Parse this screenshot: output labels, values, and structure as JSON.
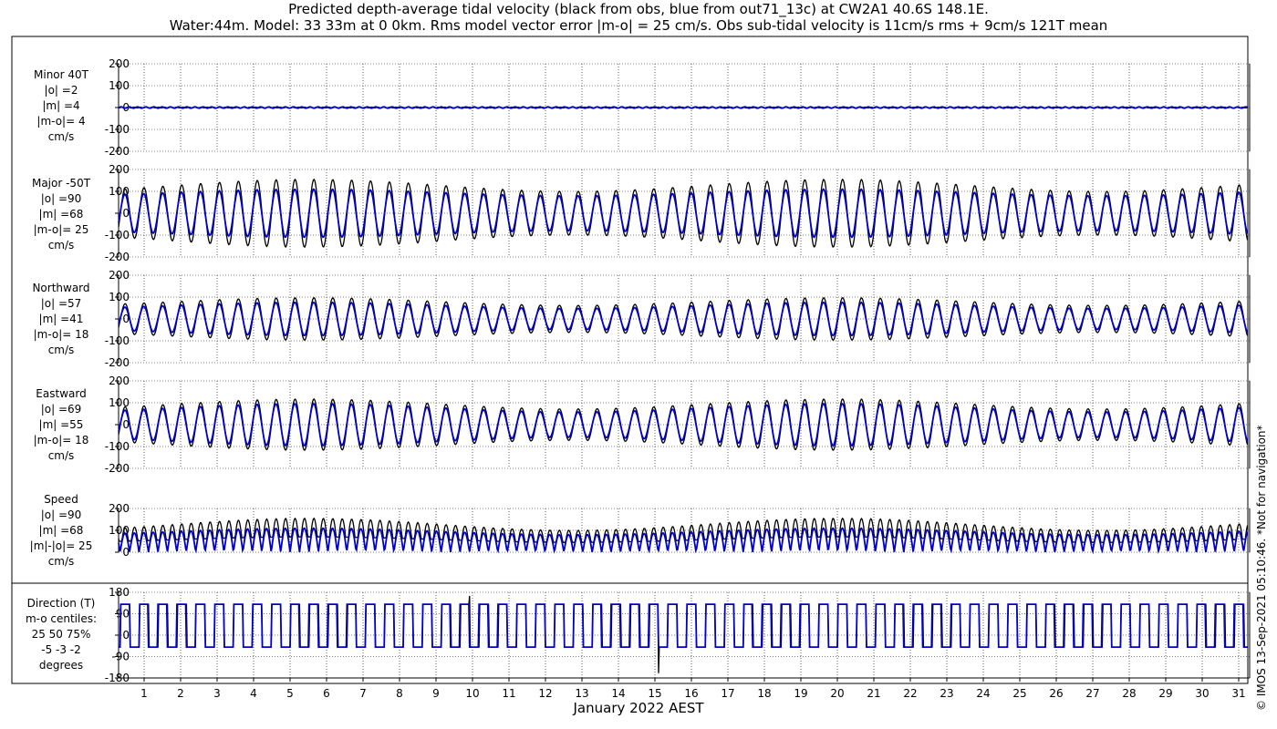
{
  "title_line1": "Predicted depth-average tidal velocity (black from obs, blue from out71_13c) at CW2A1 40.6S 148.1E.",
  "title_line2": "Water:44m. Model: 33 33m at 0 0km. Rms model vector error |m-o| = 25 cm/s. Obs sub-tidal velocity is 11cm/s rms + 9cm/s 121T mean",
  "xlabel": "January 2022 AEST",
  "stamp": "© IMOS 13-Sep-2021 05:10:46. *Not for navigation*",
  "colors": {
    "obs": "#000000",
    "model": "#0000cc",
    "grid": "#000000"
  },
  "panels": [
    {
      "label": [
        "Minor 40T",
        "|o| =2",
        "|m| =4",
        "|m-o|= 4",
        "cm/s"
      ],
      "ylim": [
        -200,
        200
      ],
      "ticks": [
        200,
        100,
        0,
        -100,
        -200
      ]
    },
    {
      "label": [
        "Major -50T",
        "|o| =90",
        "|m| =68",
        "|m-o|= 25",
        "cm/s"
      ],
      "ylim": [
        -200,
        200
      ],
      "ticks": [
        200,
        100,
        0,
        -100,
        -200
      ]
    },
    {
      "label": [
        "Northward",
        "|o| =57",
        "|m| =41",
        "|m-o|= 18",
        "cm/s"
      ],
      "ylim": [
        -200,
        200
      ],
      "ticks": [
        200,
        100,
        0,
        -100,
        -200
      ]
    },
    {
      "label": [
        "Eastward",
        "|o| =69",
        "|m| =55",
        "|m-o|= 18",
        "cm/s"
      ],
      "ylim": [
        -200,
        200
      ],
      "ticks": [
        200,
        100,
        0,
        -100,
        -200
      ]
    },
    {
      "label": [
        "Speed",
        "|o| =90",
        "|m| =68",
        "|m|-|o|= 25",
        "cm/s"
      ],
      "ylim": [
        0,
        200
      ],
      "ticks": [
        200,
        100,
        0
      ]
    },
    {
      "label": [
        "Direction (T)",
        "m-o centiles:",
        "25  50  75%",
        "-5 -3 -2",
        "degrees"
      ],
      "ylim": [
        -180,
        180
      ],
      "ticks": [
        180,
        90,
        0,
        -90,
        -180
      ]
    }
  ],
  "chart_data": {
    "type": "line",
    "x_axis": {
      "label": "January 2022 AEST",
      "range": [
        0.3,
        31.3
      ],
      "ticks": [
        1,
        2,
        3,
        4,
        5,
        6,
        7,
        8,
        9,
        10,
        11,
        12,
        13,
        14,
        15,
        16,
        17,
        18,
        19,
        20,
        21,
        22,
        23,
        24,
        25,
        26,
        27,
        28,
        29,
        30,
        31
      ]
    },
    "tidal_period_days": 0.5175,
    "series": [
      {
        "name": "obs",
        "color": "#000000"
      },
      {
        "name": "model",
        "color": "#0000cc"
      }
    ],
    "approx_amplitude_cm_s": {
      "minor": {
        "obs": 2,
        "model": 4
      },
      "major": {
        "obs_range": [
          90,
          160
        ],
        "model_range": [
          75,
          115
        ]
      },
      "northward": {
        "obs_range": [
          55,
          100
        ],
        "model_range": [
          45,
          80
        ]
      },
      "eastward": {
        "obs_range": [
          65,
          120
        ],
        "model_range": [
          55,
          100
        ]
      },
      "speed": {
        "obs_range": [
          60,
          160
        ],
        "model_range": [
          50,
          115
        ]
      },
      "direction_deg": {
        "high": 130,
        "low": -50
      }
    },
    "grid": true
  }
}
